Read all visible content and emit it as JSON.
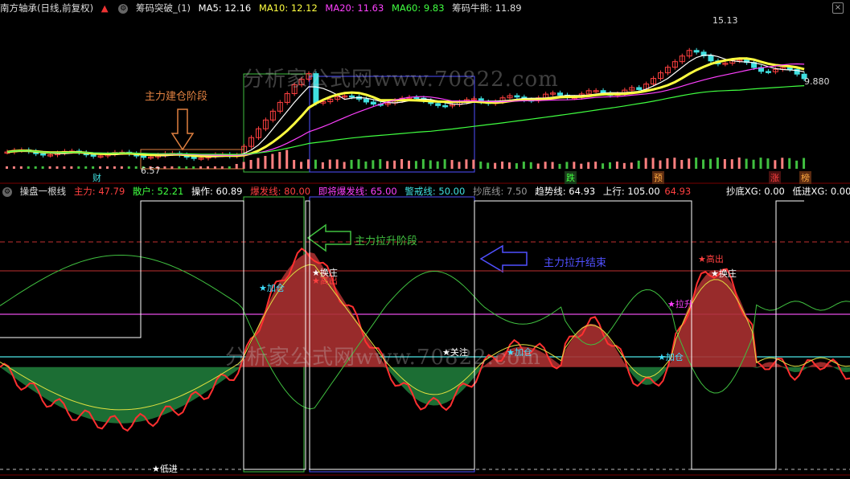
{
  "top": {
    "stock_name": "南方轴承(日线,前复权)",
    "indicator": "筹码突破_(1)",
    "ma5": "MA5: 12.16",
    "ma10": "MA10: 12.12",
    "ma20": "MA20: 11.63",
    "ma60": "MA60: 9.83",
    "chip": "筹码牛熊: 11.89"
  },
  "bottom": {
    "indicator": "操盘一根线",
    "zhuli": "主力: 47.79",
    "sanhu": "散户: 52.21",
    "caozuo": "操作: 60.89",
    "baofa": "爆发线: 80.00",
    "jijiang": "即将爆发线: 65.00",
    "jingjie": "警戒线: 50.00",
    "chaodi": "抄底线: 7.50",
    "qushi": "趋势线: 64.93",
    "shangxing": "上行: 105.00",
    "val": "64.93",
    "chaodixg": "抄底XG: 0.00",
    "dijinxg": "低进XG: 0.00",
    "jiacang": "加仓"
  },
  "prices": {
    "high": "15.13",
    "low": "6.57",
    "right": "9.880"
  },
  "annotations": {
    "jiancang": "主力建仓阶段",
    "lasheng": "主力拉升阶段",
    "lasheng_end": "主力拉升结束"
  },
  "tags": {
    "cai": "财",
    "die": "跌",
    "yu": "预",
    "zhang": "涨",
    "bang": "榜"
  },
  "signals": {
    "jiacang1": "★加仓",
    "huanzhuang1": "★换庄",
    "gaochu1": "★高出",
    "guanzhu": "★关注",
    "jiacang2": "★加仓",
    "jiacang3": "★加仓",
    "lasheng": "★拉升",
    "gaochu2": "★高出",
    "huanzhuang2": "★换庄",
    "dijin": "★低进"
  },
  "watermark": "分析家公式网www.70822.com",
  "colors": {
    "up": "#ff4040",
    "down": "#40e0e0",
    "ma5": "#ffffff",
    "ma10": "#ffff40",
    "ma20": "#ff40ff",
    "ma60": "#40ff40"
  }
}
